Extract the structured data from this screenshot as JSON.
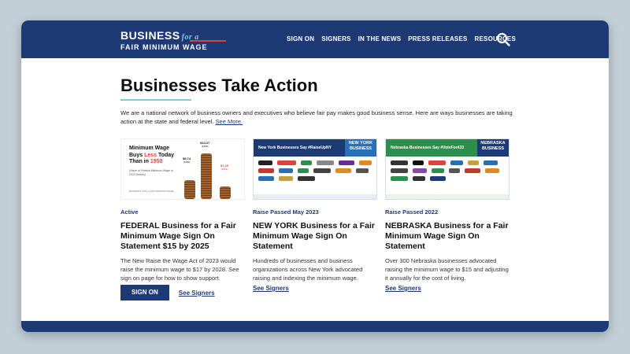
{
  "header": {
    "logo_main": "BUSINESS",
    "logo_script": "for a",
    "logo_sub": "FAIR MINIMUM WAGE",
    "nav": [
      "SIGN ON",
      "SIGNERS",
      "IN THE NEWS",
      "PRESS RELEASES",
      "RESOURCES"
    ],
    "search_icon": "search-icon"
  },
  "page": {
    "title": "Businesses Take Action",
    "intro": "We are a national network of business owners and executives who believe fair pay makes good business sense. Here are ways businesses are taking action at the state and federal level.",
    "see_more": "See More."
  },
  "cards": [
    {
      "status": "Active",
      "title": "FEDERAL Business for a Fair Minimum Wage Sign On Statement $15 by 2025",
      "desc": "The New Raise the Wage Act of 2023 would raise the minimum wage to $17 by 2028. See sign on page for how to show support.",
      "button": "SIGN ON",
      "link": "See Signers",
      "thumb": {
        "line1": "Minimum Wage",
        "line2a": "Buys ",
        "line2b": "Less",
        "line2c": " Today",
        "line3a": "Than in ",
        "line3b": "1950",
        "sub": "(Value of Federal Minimum Wage in 2023 Dollars)",
        "v1": "$9.74",
        "y1": "(1950)",
        "v2": "$14.27",
        "y2": "(1968)",
        "v3": "$7.25",
        "y3": "(2023)",
        "foot": "BUSINESS FOR A FAIR MINIMUM WAGE"
      }
    },
    {
      "status": "Raise Passed May 2023",
      "title": "NEW YORK Business for a Fair Minimum Wage Sign On Statement",
      "desc": "Hundreds of businesses and business organizations across New York advocated raising and indexing the minimum wage.",
      "link": "See Signers",
      "thumb": {
        "banner": "New York Businesses Say #RaiseUpNY",
        "tag": "NEW YORK BUSINESS"
      }
    },
    {
      "status": "Raise Passed 2022",
      "title": "NEBRASKA Business for a Fair Minimum Wage Sign On Statement",
      "desc": "Over 300 Nebraska businesses advocated raising the minimum wage to $15 and adjusting it annually for the cost of living.",
      "link": "See Signers",
      "thumb": {
        "banner": "Nebraska Businesses Say #VoteFor433",
        "tag": "NEBRASKA BUSINESS"
      }
    }
  ],
  "colors": {
    "brand_navy": "#1e3a75",
    "accent_blue": "#7ec8e3",
    "accent_red": "#d9443b",
    "ny_green": "#2d8f4e",
    "ne_gold": "#c8a03a"
  }
}
